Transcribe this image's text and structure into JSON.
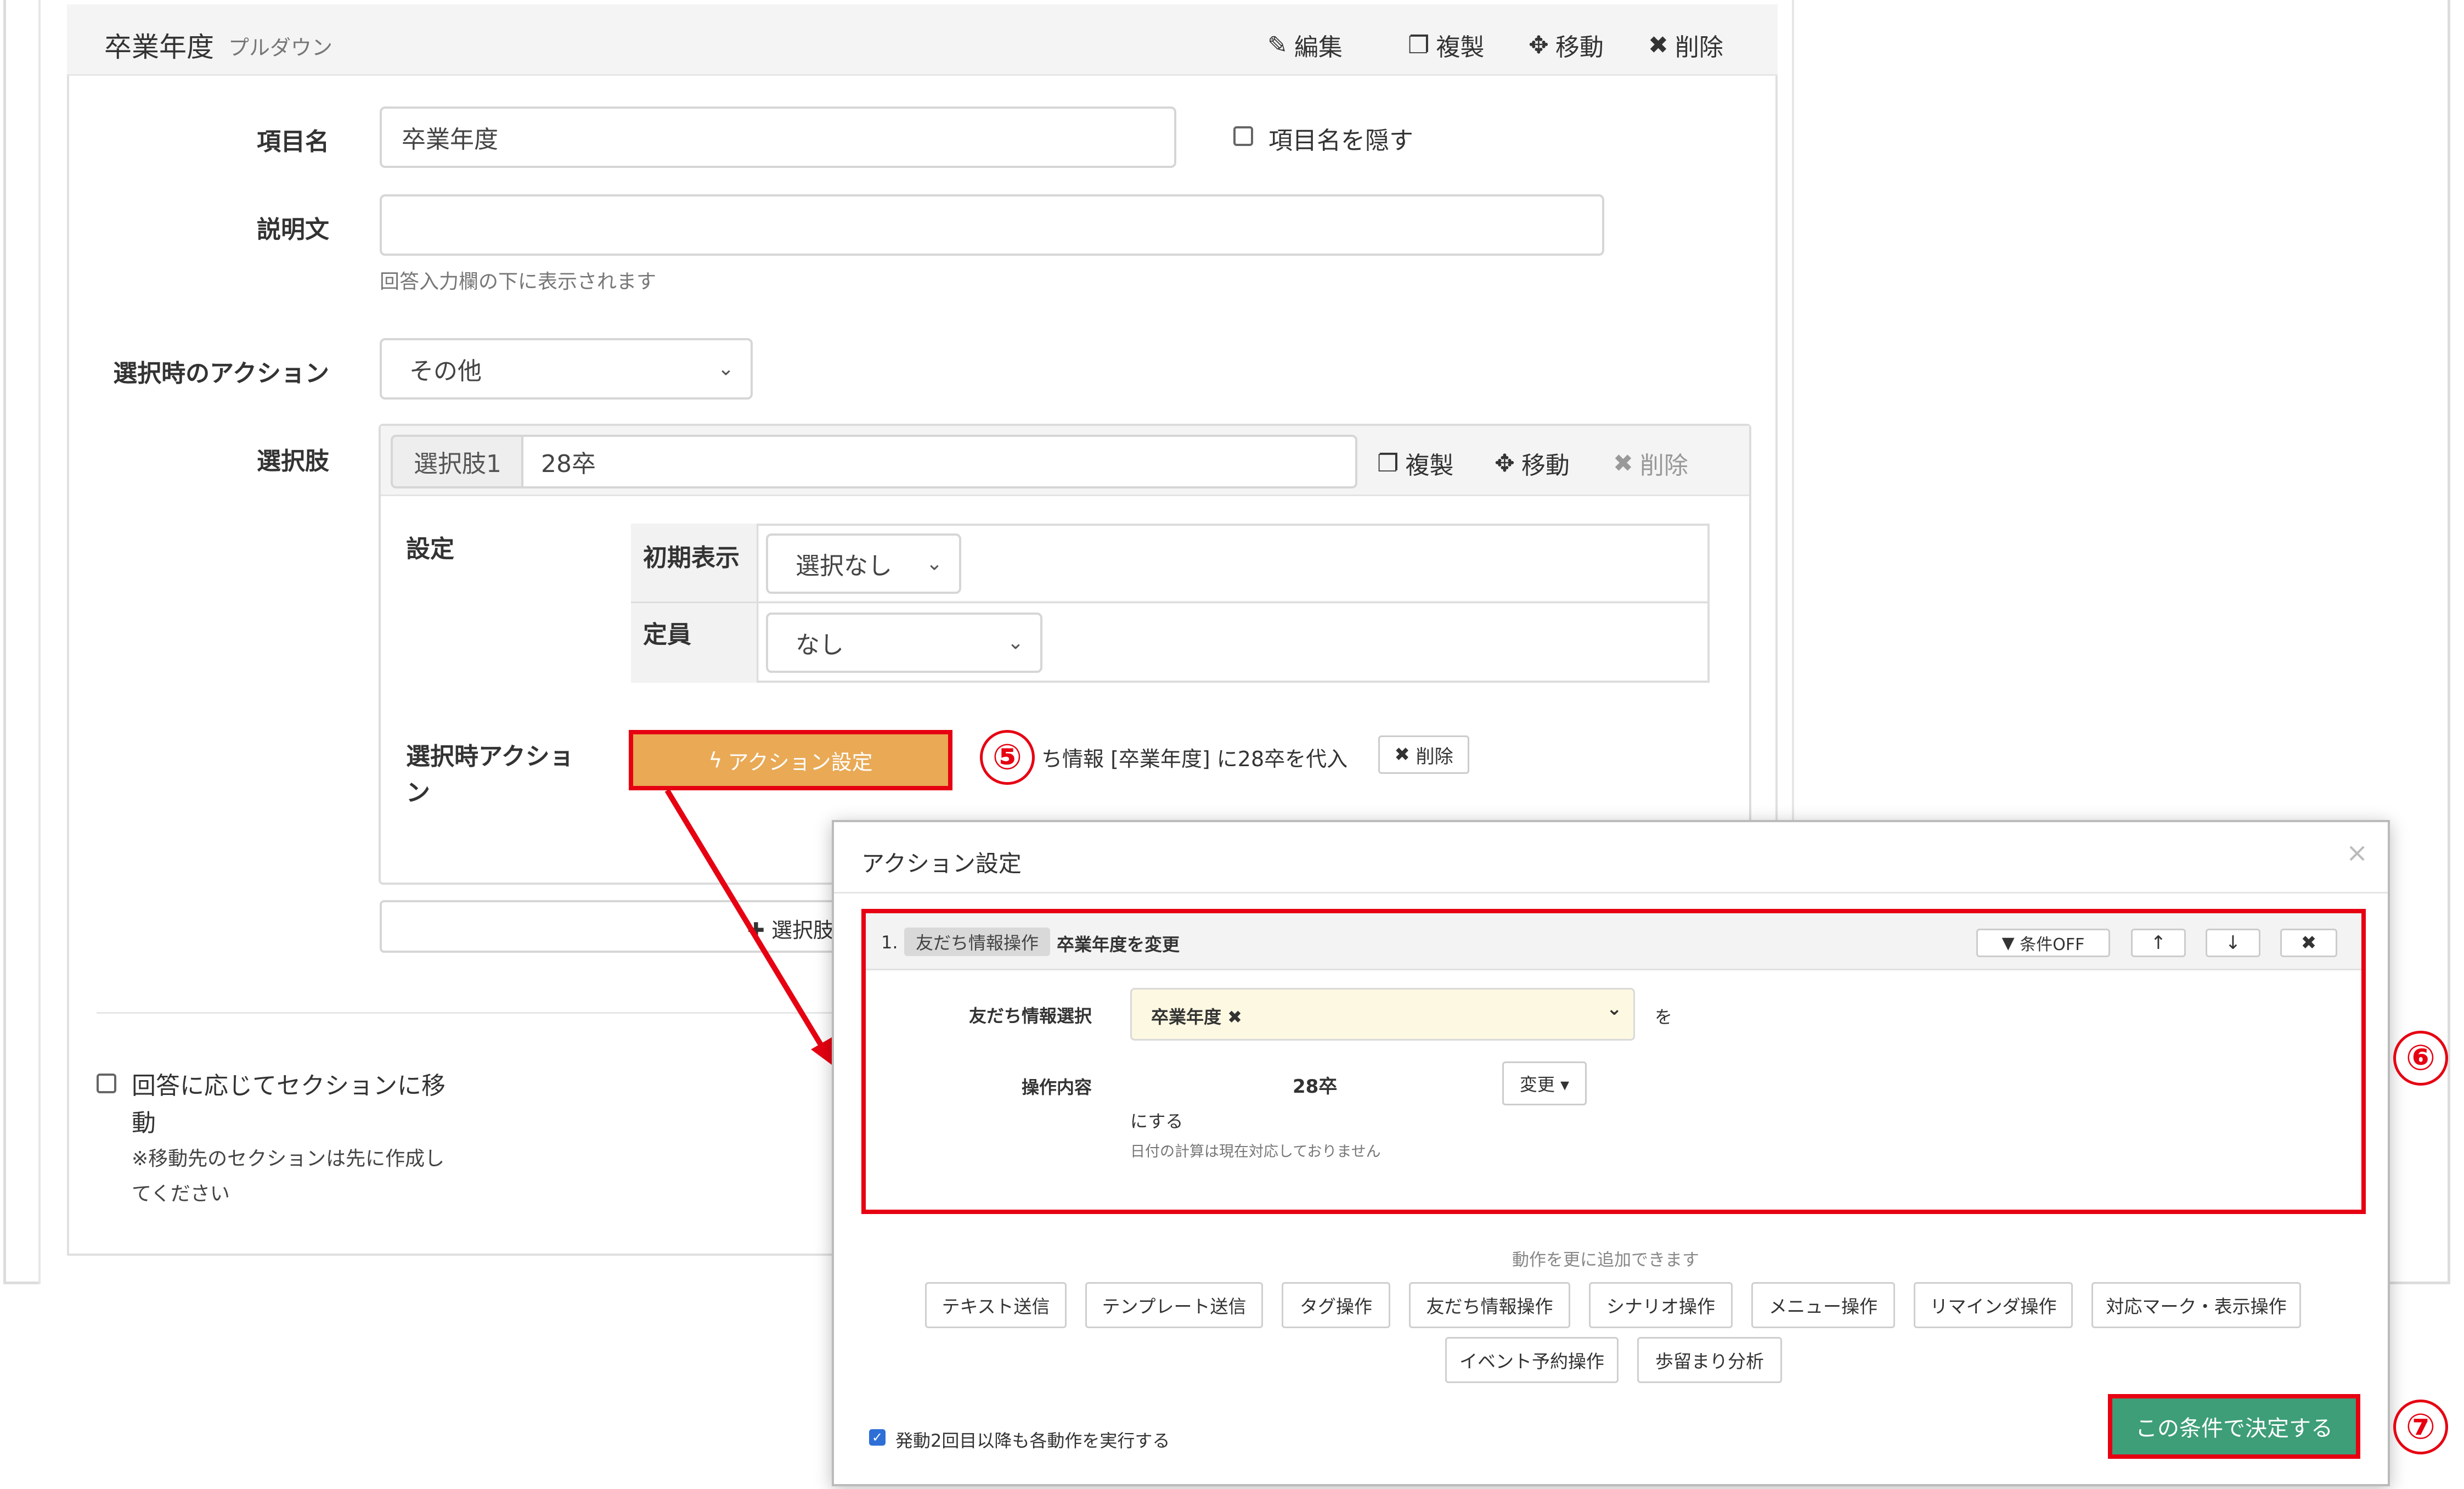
{
  "card": {
    "title": "卒業年度",
    "type_label": "プルダウン",
    "edit": "編集",
    "copy": "複製",
    "move": "移動",
    "delete": "削除"
  },
  "form": {
    "item_name_label": "項目名",
    "item_name_value": "卒業年度",
    "hide_name_label": "項目名を隠す",
    "description_label": "説明文",
    "description_help": "回答入力欄の下に表示されます",
    "select_action_label": "選択時のアクション",
    "select_action_value": "その他",
    "options_label": "選択肢"
  },
  "option": {
    "addon": "選択肢1",
    "value": "28卒",
    "copy": "複製",
    "move": "移動",
    "delete": "削除",
    "settings_label": "設定",
    "initial_label": "初期表示",
    "initial_value": "選択なし",
    "capacity_label": "定員",
    "capacity_value": "なし",
    "action_label_1": "選択時アクショ",
    "action_label_2": "ン",
    "action_button": "アクション設定",
    "action_summary": "ち情報 [卒業年度] に28卒を代入",
    "action_delete": "削除",
    "add_option": "選択肢"
  },
  "section_jump": {
    "label_1": "回答に応じてセクションに移",
    "label_2": "動",
    "note_1": "※移動先のセクションは先に作成し",
    "note_2": "てください"
  },
  "annotations": {
    "step5": "⑤",
    "step6": "⑥",
    "step7": "⑦"
  },
  "modal": {
    "title": "アクション設定",
    "close": "×",
    "row_index": "1.",
    "row_tag": "友だち情報操作",
    "row_title": "卒業年度を変更",
    "cond_off": "条件OFF",
    "up": "↑",
    "down": "↓",
    "remove": "✖",
    "friend_select_label": "友だち情報選択",
    "friend_select_value": "卒業年度 ✖",
    "wo": "を",
    "op_label": "操作内容",
    "op_value": "28卒",
    "change_button": "変更 ▾",
    "suru": "にする",
    "date_note": "日付の計算は現在対応しておりません",
    "add_more": "動作を更に追加できます",
    "actions_row1": [
      "テキスト送信",
      "テンプレート送信",
      "タグ操作",
      "友だち情報操作",
      "シナリオ操作",
      "メニュー操作",
      "リマインダ操作",
      "対応マーク・表示操作"
    ],
    "actions_row2": [
      "イベント予約操作",
      "歩留まり分析"
    ],
    "repeat_label": "発動2回目以降も各動作を実行する",
    "confirm": "この条件で決定する"
  },
  "colors": {
    "highlight_red": "#e60012",
    "action_orange": "#e9a955",
    "confirm_green": "#3d9e78"
  }
}
